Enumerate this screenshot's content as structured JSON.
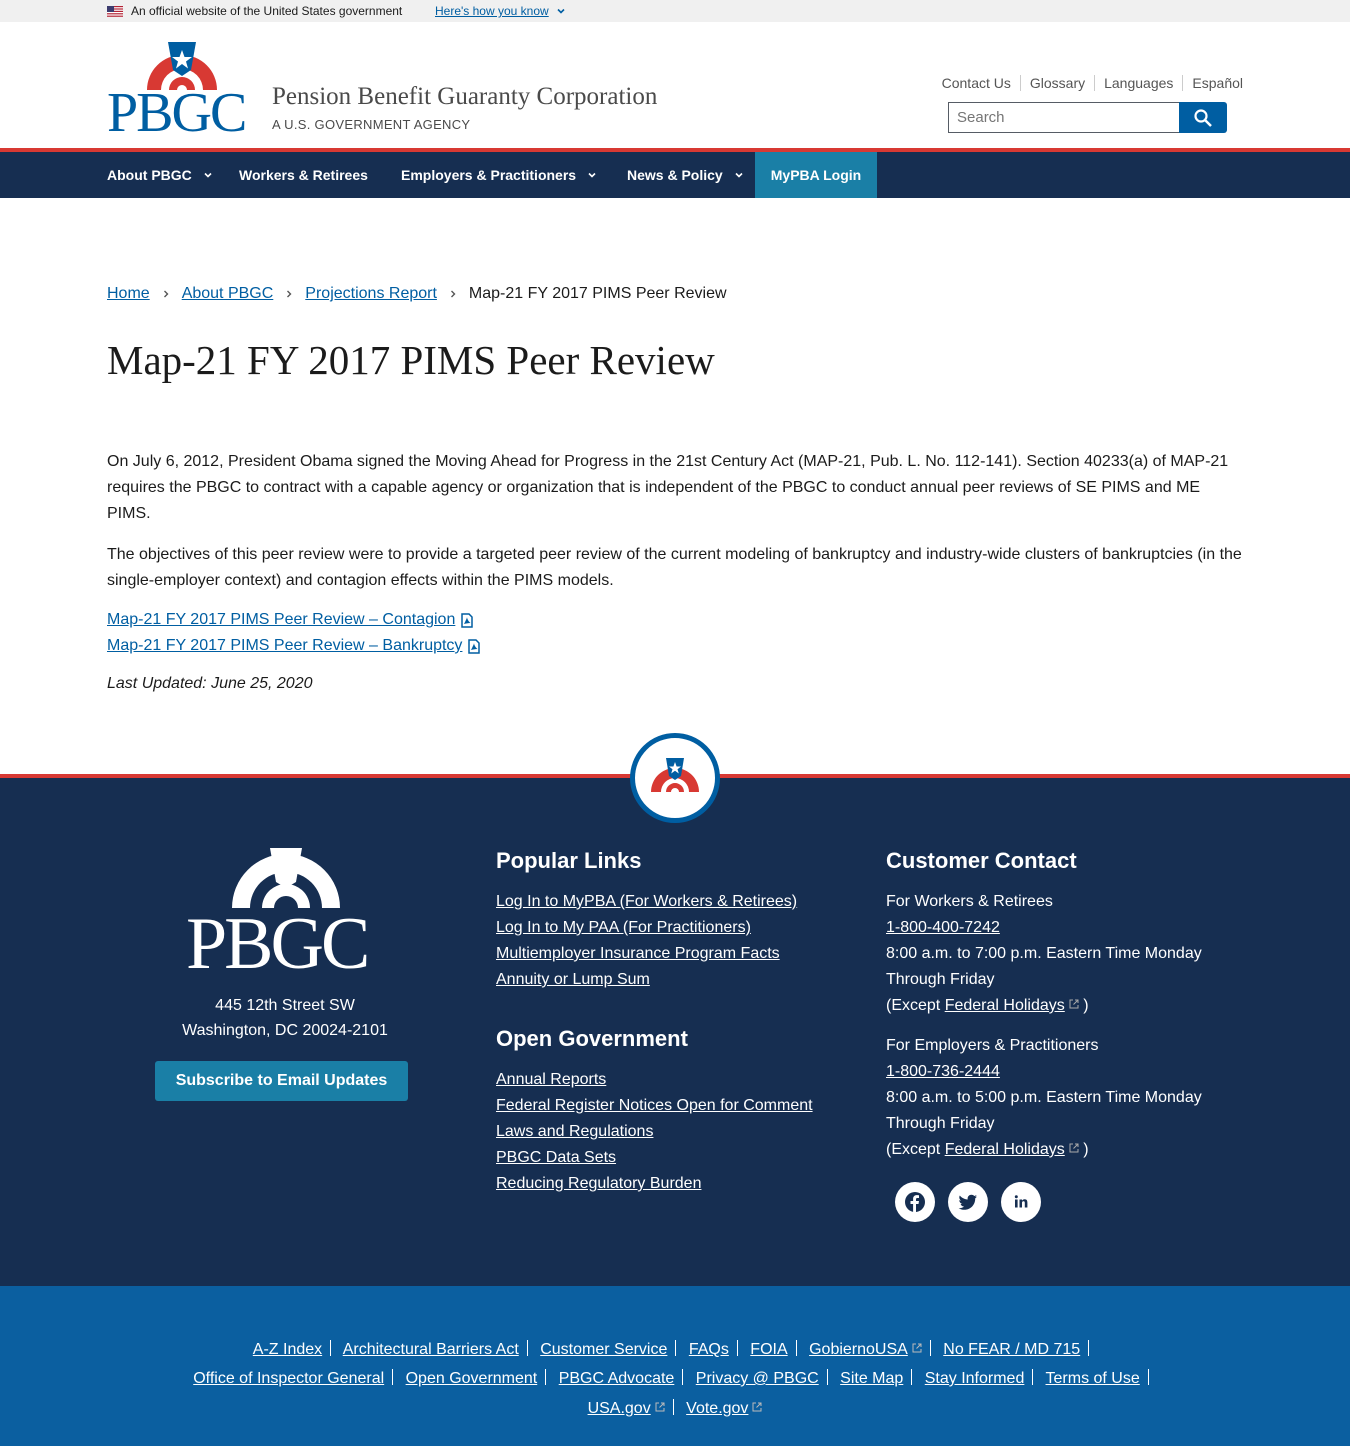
{
  "gov_banner": {
    "text": "An official website of the United States government",
    "link": "Here's how you know"
  },
  "header": {
    "agency_name": "Pension Benefit Guaranty Corporation",
    "agency_sub": "A U.S. GOVERNMENT AGENCY",
    "utility_links": [
      "Contact Us",
      "Glossary",
      "Languages",
      "Español"
    ],
    "search_placeholder": "Search"
  },
  "nav": {
    "items": [
      "About PBGC",
      "Workers & Retirees",
      "Employers & Practitioners",
      "News & Policy"
    ],
    "login": "MyPBA Login"
  },
  "breadcrumb": [
    "Home",
    "About PBGC",
    "Projections Report",
    "Map-21 FY 2017 PIMS Peer Review"
  ],
  "page": {
    "title": "Map-21 FY 2017 PIMS Peer Review",
    "paragraph1": "On July 6, 2012, President Obama signed the Moving Ahead for Progress in the 21st Century Act (MAP-21, Pub. L. No. 112-141). Section 40233(a) of MAP-21 requires the PBGC to contract with a capable agency or organization that is independent of the PBGC to conduct annual peer reviews of SE PIMS and ME PIMS.",
    "paragraph2": "The objectives of this peer review were to provide a targeted peer review of the current modeling of bankruptcy and industry-wide clusters of bankruptcies (in the single-employer context) and contagion effects within the PIMS models.",
    "doc_links": [
      "Map-21 FY 2017 PIMS Peer Review – Contagion",
      "Map-21 FY 2017 PIMS Peer Review – Bankruptcy"
    ],
    "last_updated": "Last Updated: June 25, 2020"
  },
  "footer": {
    "address_line1": "445 12th Street SW",
    "address_line2": "Washington, DC 20024-2101",
    "subscribe": "Subscribe to Email Updates",
    "popular_heading": "Popular Links",
    "popular_links": [
      "Log In to MyPBA (For Workers & Retirees)",
      "Log In to My PAA (For Practitioners)",
      "Multiemployer Insurance Program Facts",
      "Annuity or Lump Sum"
    ],
    "open_gov_heading": "Open Government",
    "open_gov_links": [
      "Annual Reports",
      "Federal Register Notices Open for Comment",
      "Laws and Regulations",
      "PBGC Data Sets",
      "Reducing Regulatory Burden"
    ],
    "contact_heading": "Customer Contact",
    "workers_label": "For Workers & Retirees",
    "workers_phone": "1-800-400-7242",
    "workers_hours": "8:00 a.m. to 7:00 p.m. Eastern Time Monday Through Friday",
    "except_prefix": "(Except ",
    "holidays_link": "Federal Holidays",
    "except_suffix": " )",
    "employers_label": "For Employers & Practitioners",
    "employers_phone": "1-800-736-2444",
    "employers_hours": "8:00 a.m. to 5:00 p.m. Eastern Time Monday Through Friday",
    "social_icons": [
      "facebook-icon",
      "twitter-icon",
      "linkedin-icon"
    ],
    "bottom_row1": [
      "A-Z Index",
      "Architectural Barriers Act",
      "Customer Service",
      "FAQs",
      "FOIA",
      "GobiernoUSA",
      "No FEAR / MD 715"
    ],
    "bottom_row2": [
      "Office of Inspector General",
      "Open Government",
      "PBGC Advocate",
      "Privacy @ PBGC",
      "Site Map",
      "Stay Informed",
      "Terms of Use"
    ],
    "bottom_row3": [
      "USA.gov",
      "Vote.gov"
    ]
  },
  "colors": {
    "navy": "#162e51",
    "red": "#d83933",
    "blue": "#005ea2",
    "teal": "#1a7fa6",
    "footer_blue": "#0b5fa0"
  }
}
